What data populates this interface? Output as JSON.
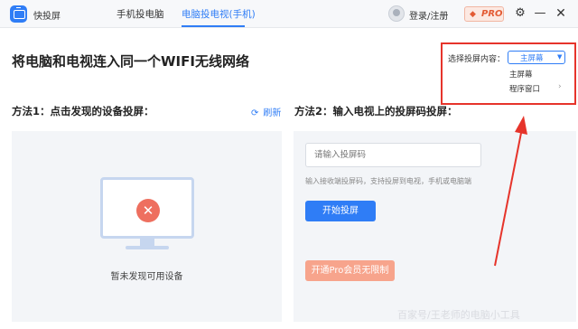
{
  "app": {
    "name": "快投屏"
  },
  "tabs": [
    {
      "label": "手机投电脑"
    },
    {
      "label": "电脑投电视(手机)"
    }
  ],
  "header": {
    "login_label": "登录/注册",
    "pro_label": "PRO"
  },
  "main": {
    "title": "将电脑和电视连入同一个WIFI无线网络",
    "method1_title": "方法1：点击发现的设备投屏：",
    "refresh_label": "刷新",
    "no_device_text": "暂未发现可用设备",
    "method2_title": "方法2：输入电视上的投屏码投屏：",
    "code_placeholder": "请输入投屏码",
    "code_value": "",
    "hint_text": "输入接收端投屏码，支持投屏到电视，手机或电脑端",
    "start_button": "开始投屏",
    "vip_button": "开通Pro会员无限制"
  },
  "screen_content": {
    "label": "选择投屏内容：",
    "selected": "主屏幕",
    "options": [
      "主屏幕",
      "程序窗口"
    ]
  },
  "watermark": "百家号/王老师的电脑小工具",
  "colors": {
    "accent": "#2f7df6",
    "annotation": "#e6342b",
    "pro": "#e35b34",
    "error": "#ee6f5f"
  }
}
